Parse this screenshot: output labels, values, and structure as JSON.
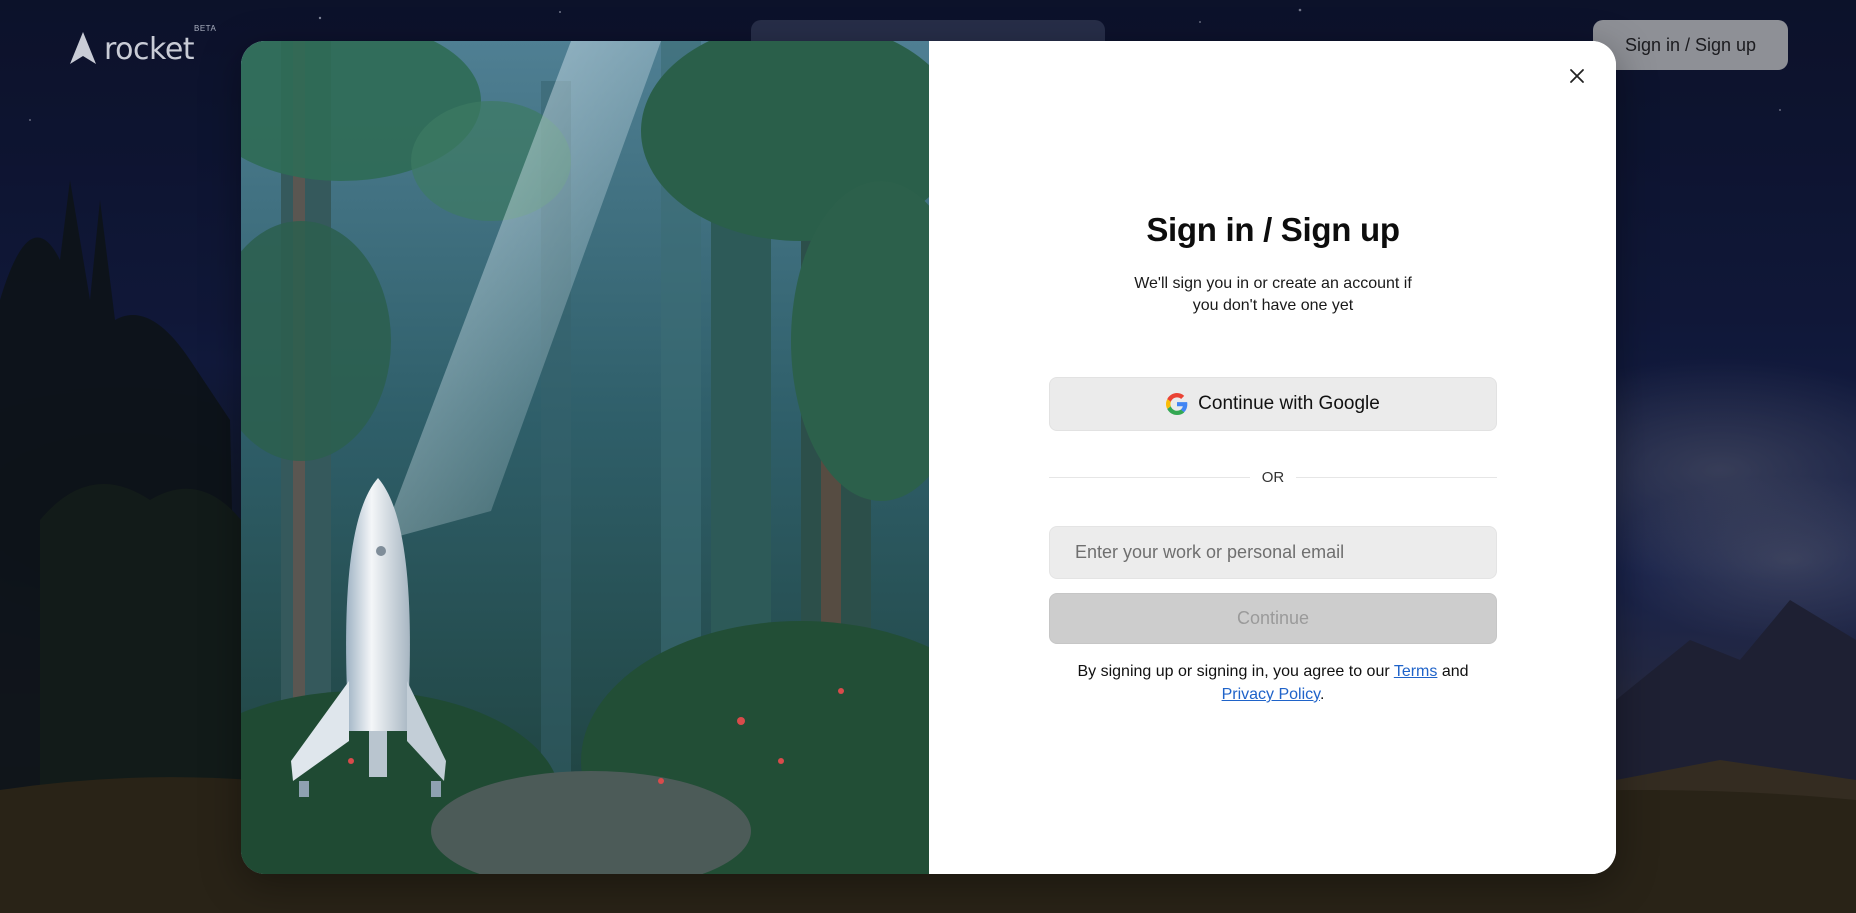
{
  "nav": {
    "logo_text": "rocket",
    "logo_badge": "BETA",
    "signin_label": "Sign in / Sign up"
  },
  "modal": {
    "title": "Sign in / Sign up",
    "subtitle": "We'll sign you in or create an account if you don't have one yet",
    "google_label": "Continue with Google",
    "divider_text": "OR",
    "email_placeholder": "Enter your work or personal email",
    "email_value": "",
    "continue_label": "Continue",
    "legal_prefix": "By signing up or signing in, you agree to our ",
    "terms_label": "Terms",
    "legal_middle": " and ",
    "privacy_label": "Privacy Policy",
    "legal_suffix": "."
  },
  "colors": {
    "link": "#1f63c9",
    "primary_disabled": "#cdcdcd",
    "panel_bg": "#ffffff",
    "backdrop": "#172251"
  },
  "icons": {
    "logo": "rocket-logo-icon",
    "close": "close-icon",
    "google": "google-icon"
  }
}
